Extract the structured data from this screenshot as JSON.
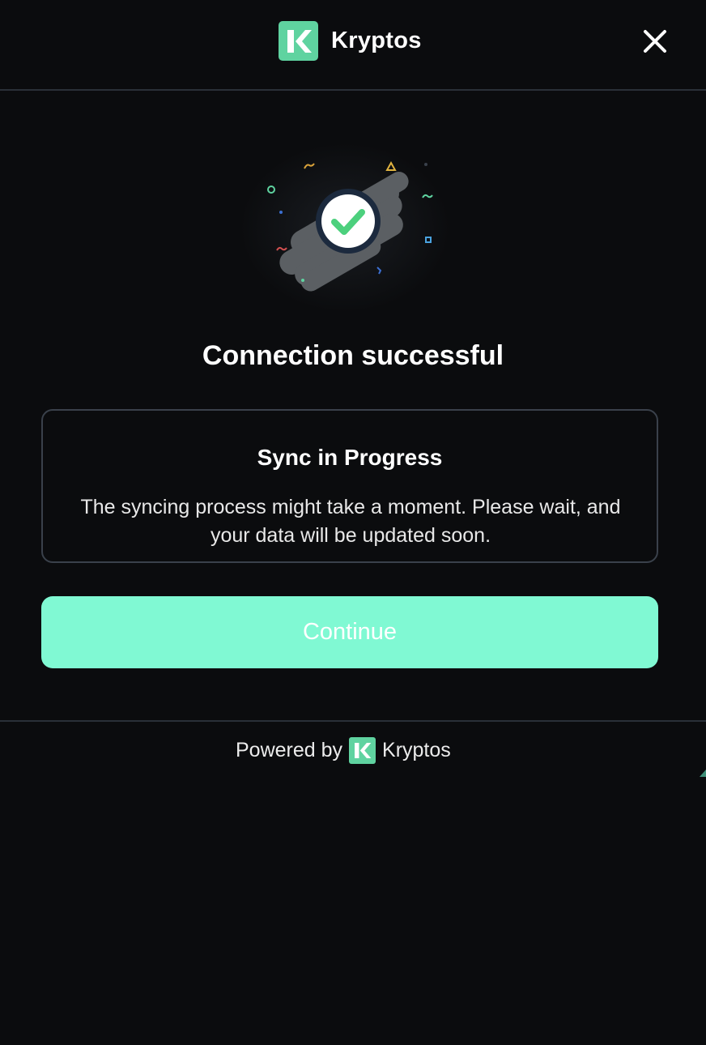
{
  "header": {
    "brand_name": "Kryptos",
    "logo_color": "#5fd3a0",
    "close_icon": "close-icon"
  },
  "illustration": {
    "icon": "success-check-icon",
    "check_color": "#4cd07d"
  },
  "main": {
    "title": "Connection successful"
  },
  "card": {
    "title": "Sync in Progress",
    "body": "The syncing process might take a moment. Please wait, and your data will be updated soon."
  },
  "actions": {
    "continue_label": "Continue",
    "continue_color": "#80f9d3"
  },
  "footer": {
    "powered_by": "Powered by",
    "brand_name": "Kryptos"
  }
}
